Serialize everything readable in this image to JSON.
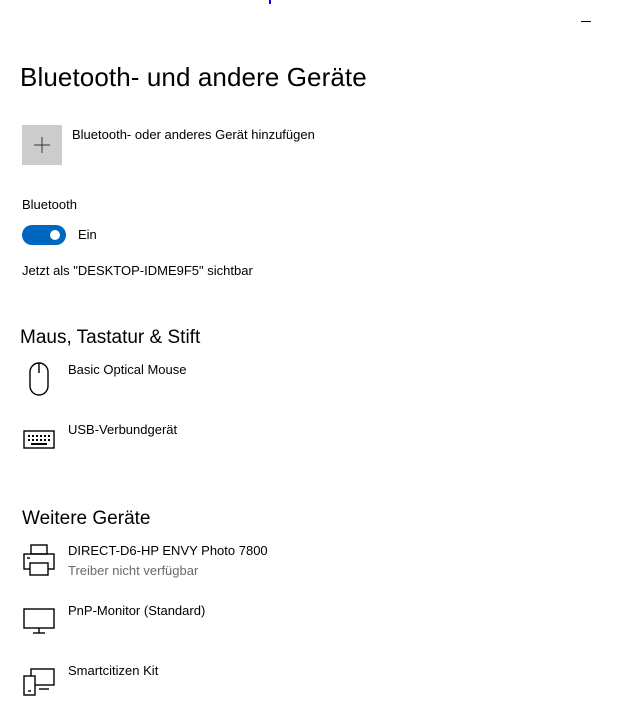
{
  "window": {
    "minimize_label": "minimize"
  },
  "page": {
    "title": "Bluetooth- und andere Geräte"
  },
  "add_device": {
    "label": "Bluetooth- oder anderes Gerät hinzufügen",
    "icon": "plus-icon"
  },
  "bluetooth": {
    "label": "Bluetooth",
    "toggle_on": true,
    "toggle_state": "Ein",
    "visible_as": "Jetzt als \"DESKTOP-IDME9F5\" sichtbar",
    "accent_color": "#0067c0"
  },
  "sections": {
    "input": {
      "title": "Maus, Tastatur & Stift",
      "devices": [
        {
          "name": "Basic Optical Mouse",
          "icon": "mouse-icon"
        },
        {
          "name": "USB-Verbundgerät",
          "icon": "keyboard-icon"
        }
      ]
    },
    "other": {
      "title": "Weitere Geräte",
      "devices": [
        {
          "name": "DIRECT-D6-HP ENVY Photo 7800",
          "status": "Treiber nicht verfügbar",
          "icon": "printer-icon"
        },
        {
          "name": "PnP-Monitor (Standard)",
          "icon": "monitor-icon"
        },
        {
          "name": "Smartcitizen Kit",
          "icon": "devices-icon"
        }
      ]
    }
  }
}
